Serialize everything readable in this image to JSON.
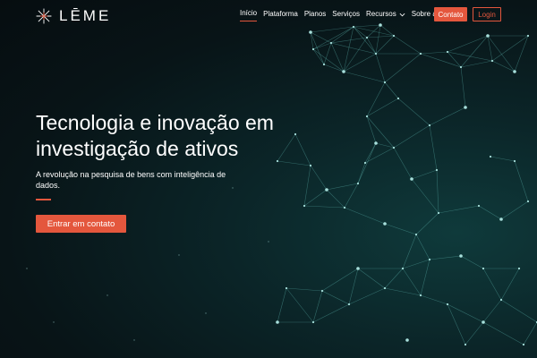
{
  "brand": {
    "name": "LĒME",
    "logo_icon": "asterisk-star-icon"
  },
  "nav": {
    "items": [
      {
        "label": "Início",
        "active": true
      },
      {
        "label": "Plataforma"
      },
      {
        "label": "Planos"
      },
      {
        "label": "Serviços"
      },
      {
        "label": "Recursos",
        "has_dropdown": true
      },
      {
        "label": "Sobre a LEME"
      }
    ],
    "contact_label": "Contato",
    "login_label": "Login"
  },
  "hero": {
    "title_line1": "Tecnologia e inovação em",
    "title_line2": "investigação de ativos",
    "subtitle": "A revolução na pesquisa de bens com inteligência de dados.",
    "cta_label": "Entrar em contato"
  },
  "colors": {
    "accent": "#e4573d",
    "background": "#081417",
    "network": "#5fb8b2"
  }
}
